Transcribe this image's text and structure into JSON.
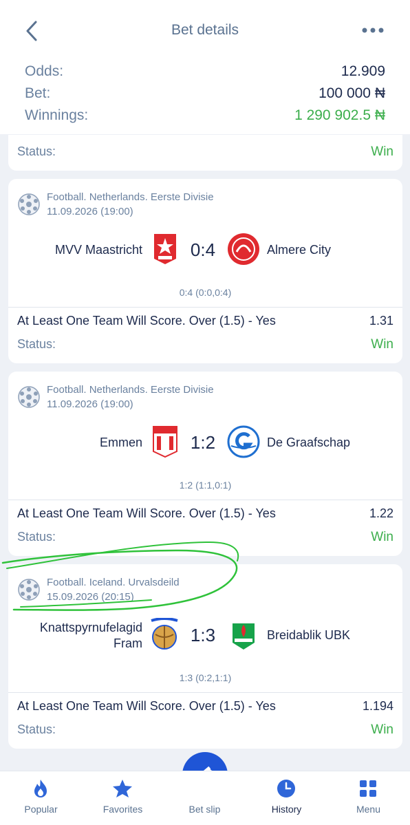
{
  "header": {
    "title": "Bet details"
  },
  "summary": {
    "odds_label": "Odds:",
    "odds_value": "12.909",
    "bet_label": "Bet:",
    "bet_value": "100 000 ₦",
    "winnings_label": "Winnings:",
    "winnings_value": "1 290 902.5 ₦"
  },
  "overall_status": {
    "label": "Status:",
    "value": "Win"
  },
  "events": [
    {
      "league": "Football. Netherlands. Eerste Divisie",
      "datetime": "11.09.2026 (19:00)",
      "home": "MVV Maastricht",
      "away": "Almere City",
      "score": "0:4",
      "detail": "0:4 (0:0,0:4)",
      "market": "At Least One Team Will Score. Over (1.5) - Yes",
      "odds": "1.31",
      "status_label": "Status:",
      "status": "Win"
    },
    {
      "league": "Football. Netherlands. Eerste Divisie",
      "datetime": "11.09.2026 (19:00)",
      "home": "Emmen",
      "away": "De Graafschap",
      "score": "1:2",
      "detail": "1:2 (1:1,0:1)",
      "market": "At Least One Team Will Score. Over (1.5) - Yes",
      "odds": "1.22",
      "status_label": "Status:",
      "status": "Win"
    },
    {
      "league": "Football. Iceland. Urvalsdeild",
      "datetime": "15.09.2026 (20:15)",
      "home_line1": "Knattspyrnufelagid",
      "home_line2": "Fram",
      "away": "Breidablik UBK",
      "score": "1:3",
      "detail": "1:3 (0:2,1:1)",
      "market": "At Least One Team Will Score. Over (1.5) - Yes",
      "odds": "1.194",
      "status_label": "Status:",
      "status": "Win"
    }
  ],
  "nav": {
    "items": [
      {
        "label": "Popular",
        "icon": "flame-icon"
      },
      {
        "label": "Favorites",
        "icon": "star-icon"
      },
      {
        "label": "Bet slip",
        "icon": "ticket-icon"
      },
      {
        "label": "History",
        "icon": "clock-icon"
      },
      {
        "label": "Menu",
        "icon": "grid-icon"
      }
    ],
    "active": "History"
  },
  "colors": {
    "win": "#3cae4c",
    "accent": "#1f55d6",
    "annotation": "#2fc23a"
  }
}
